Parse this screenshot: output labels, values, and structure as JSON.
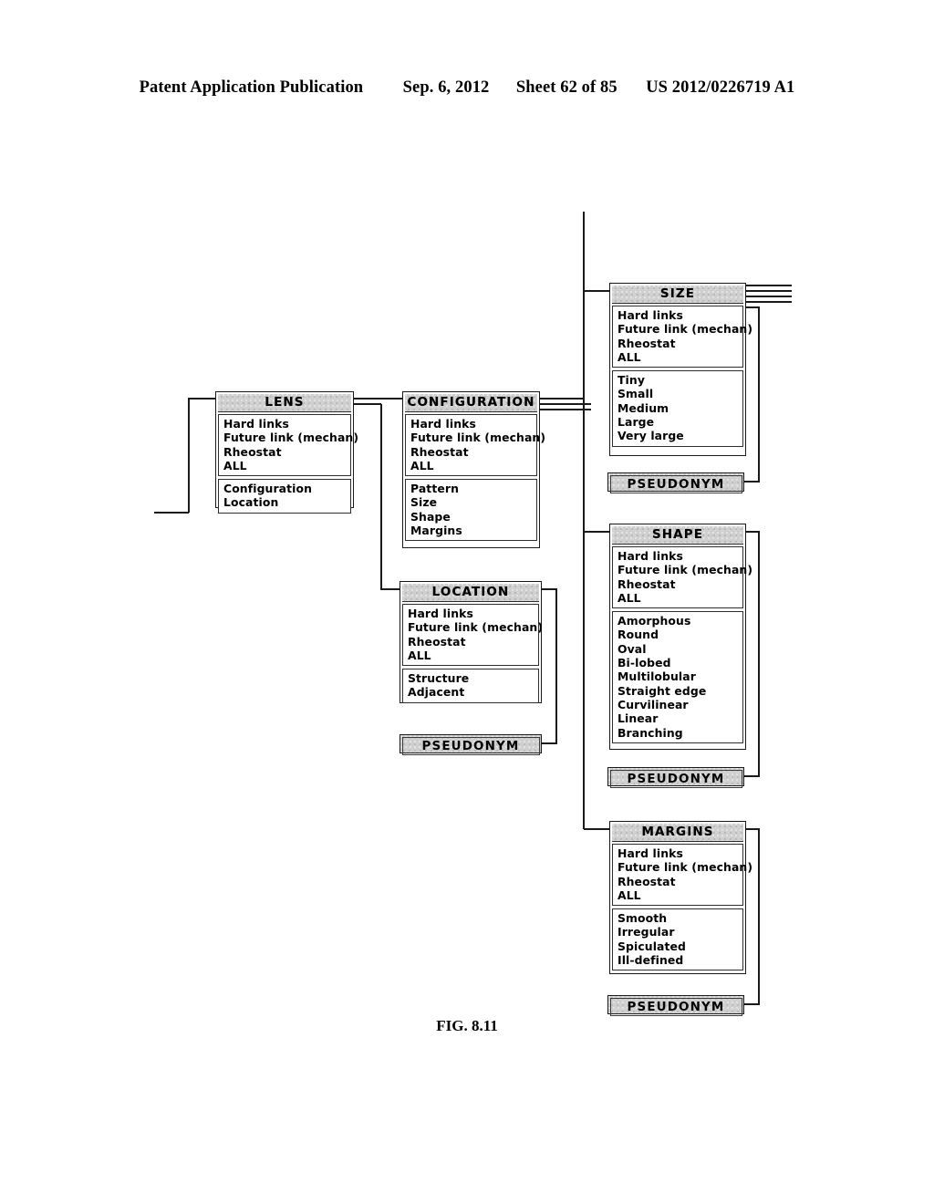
{
  "header": {
    "publication": "Patent Application Publication",
    "date": "Sep. 6, 2012",
    "sheet": "Sheet 62 of 85",
    "number": "US 2012/0226719 A1"
  },
  "figure": {
    "caption": "FIG. 8.11"
  },
  "common": {
    "link_section": [
      "Hard links",
      "Future link (mechan)",
      "Rheostat",
      "ALL"
    ],
    "pseudonym_label": "PSEUDONYM"
  },
  "entities": {
    "lens": {
      "title": "LENS",
      "attributes": [
        "Hard links",
        "Future link (mechan)",
        "Rheostat",
        "ALL"
      ],
      "values": [
        "Configuration",
        "Location"
      ]
    },
    "configuration": {
      "title": "CONFIGURATION",
      "attributes": [
        "Hard links",
        "Future link (mechan)",
        "Rheostat",
        "ALL"
      ],
      "values": [
        "Pattern",
        "Size",
        "Shape",
        "Margins"
      ]
    },
    "size": {
      "title": "SIZE",
      "attributes": [
        "Hard links",
        "Future link (mechan)",
        "Rheostat",
        "ALL"
      ],
      "values": [
        "Tiny",
        "Small",
        "Medium",
        "Large",
        "Very large"
      ]
    },
    "shape": {
      "title": "SHAPE",
      "attributes": [
        "Hard links",
        "Future link (mechan)",
        "Rheostat",
        "ALL"
      ],
      "values": [
        "Amorphous",
        "Round",
        "Oval",
        "Bi-lobed",
        "Multilobular",
        "Straight edge",
        "Curvilinear",
        "Linear",
        "Branching"
      ]
    },
    "margins": {
      "title": "MARGINS",
      "attributes": [
        "Hard links",
        "Future link (mechan)",
        "Rheostat",
        "ALL"
      ],
      "values": [
        "Smooth",
        "Irregular",
        "Spiculated",
        "Ill-defined"
      ]
    },
    "location": {
      "title": "LOCATION",
      "attributes": [
        "Hard links",
        "Future link (mechan)",
        "Rheostat",
        "ALL"
      ],
      "values": [
        "Structure",
        "Adjacent"
      ]
    }
  },
  "pseudonyms": {
    "size": "PSEUDONYM",
    "shape": "PSEUDONYM",
    "margins": "PSEUDONYM",
    "location": "PSEUDONYM"
  },
  "colors": {
    "line": "#1a1a1a",
    "title_fill": "#cfcfcf",
    "background": "#ffffff"
  }
}
